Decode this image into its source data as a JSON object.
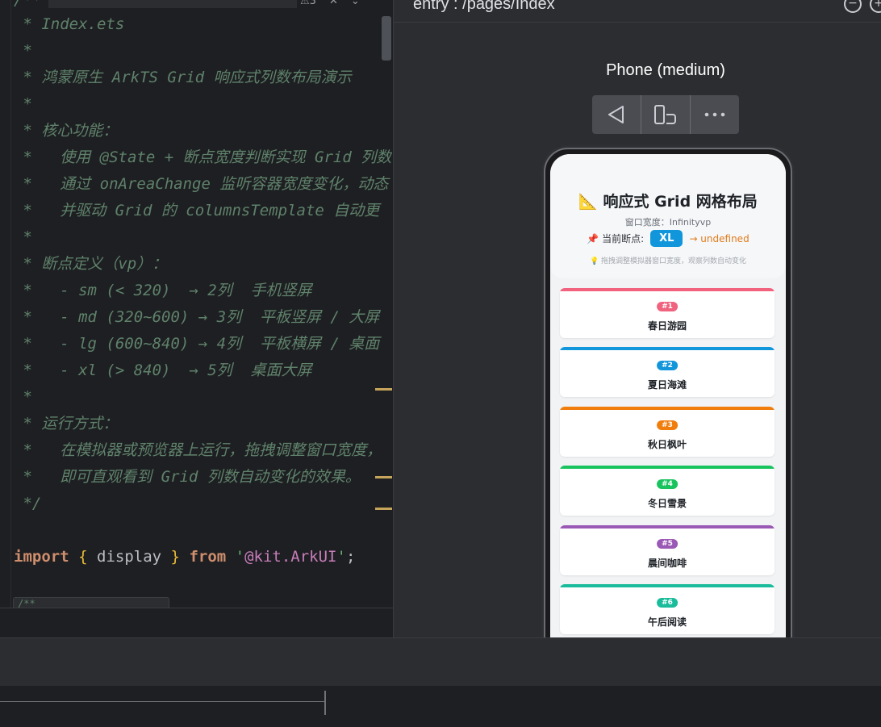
{
  "editor": {
    "lines": [
      " * Index.ets",
      " *",
      " * 鸿蒙原生 ArkTS Grid 响应式列数布局演示",
      " *",
      " * 核心功能：",
      " *   使用 @State + 断点宽度判断实现 Grid 列数",
      " *   通过 onAreaChange 监听容器宽度变化，动态",
      " *   并驱动 Grid 的 columnsTemplate 自动更",
      " *",
      " * 断点定义（vp）：",
      " *   - sm (< 320)  → 2列  手机竖屏",
      " *   - md (320~600) → 3列  平板竖屏 / 大屏",
      " *   - lg (600~840) → 4列  平板横屏 / 桌面",
      " *   - xl (> 840)  → 5列  桌面大屏",
      " *",
      " * 运行方式：",
      " *   在模拟器或预览器上运行，拖拽调整窗口宽度，",
      " *   即可直观看到 Grid 列数自动变化的效果。",
      " */"
    ],
    "import_line": {
      "kw_import": "import",
      "brace_open": "{",
      "name": "display",
      "brace_close": "}",
      "kw_from": "from",
      "module": "'@kit.ArkUI'",
      "semicolon": ";"
    },
    "top_fragment": "/**",
    "warning_count": "3",
    "peek_text": "/**"
  },
  "previewer": {
    "title": "entry : /pages/Index",
    "device_label": "Phone (medium)",
    "app": {
      "title": "📐 响应式 Grid 网格布局",
      "width_text": "窗口宽度：Infinityvp",
      "breakpoint_label": "📌 当前断点:",
      "breakpoint_badge": "XL",
      "breakpoint_desc": "→ undefined",
      "tip": "💡 拖拽调整模拟器窗口宽度，观察列数自动变化",
      "items": [
        {
          "num": "#1",
          "name": "春日游园",
          "color": "#f0627e"
        },
        {
          "num": "#2",
          "name": "夏日海滩",
          "color": "#1296db"
        },
        {
          "num": "#3",
          "name": "秋日枫叶",
          "color": "#f07d0c"
        },
        {
          "num": "#4",
          "name": "冬日雪景",
          "color": "#19c35e"
        },
        {
          "num": "#5",
          "name": "晨间咖啡",
          "color": "#9b59b6"
        },
        {
          "num": "#6",
          "name": "午后阅读",
          "color": "#1abc9c"
        }
      ]
    }
  }
}
